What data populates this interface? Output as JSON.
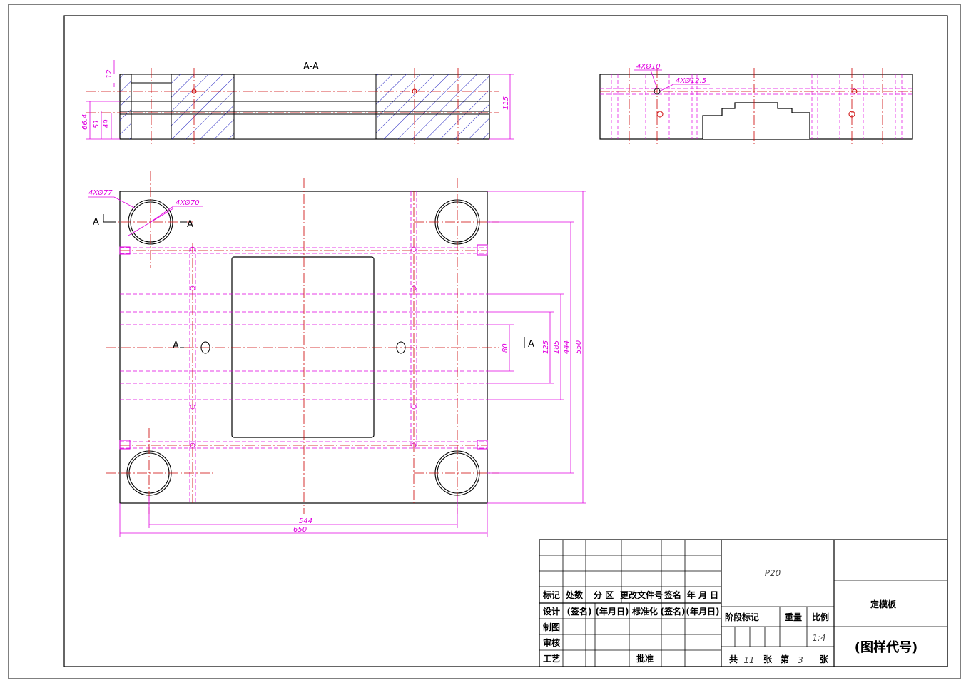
{
  "section_title": "A-A",
  "section_marks": [
    "A",
    "A",
    "A",
    "A"
  ],
  "top_view": {
    "dims": {
      "d1": "12",
      "d2": "66.4",
      "d3": "51",
      "d4": "49",
      "d5": "115"
    }
  },
  "side_view": {
    "callouts": {
      "c1": "4XØ10",
      "c2": "4XØ12.5"
    }
  },
  "plan_view": {
    "callouts": {
      "c1": "4XØ77",
      "c2": "4XØ70"
    },
    "dims": {
      "w_inner": "544",
      "w_outer": "650",
      "h1": "80",
      "h2": "125",
      "h3": "185",
      "h4": "444",
      "h5": "550"
    }
  },
  "title_block": {
    "headers": [
      "标记",
      "处数",
      "分 区",
      "更改文件号",
      "签名",
      "年 月 日"
    ],
    "row_design": [
      "设计",
      "(签名)",
      "(年月日)",
      "标准化",
      "(签名)",
      "(年月日)"
    ],
    "row_labels": {
      "draw": "制图",
      "check": "审核",
      "process": "工艺",
      "approve": "批准"
    },
    "material": "P20",
    "stage_label": "阶段标记",
    "weight_label": "重量",
    "scale_label": "比例",
    "scale_value": "1:4",
    "part_name": "定模板",
    "drawing_code": "(图样代号)",
    "sheets": {
      "total_prefix": "共",
      "total": "11",
      "unit1": "张",
      "current_prefix": "第",
      "current": "3",
      "unit2": "张"
    }
  },
  "colors": {
    "outline": "#000000",
    "centerline": "#cc0000",
    "dimension": "#e000e0",
    "hatch": "#2020c0"
  }
}
